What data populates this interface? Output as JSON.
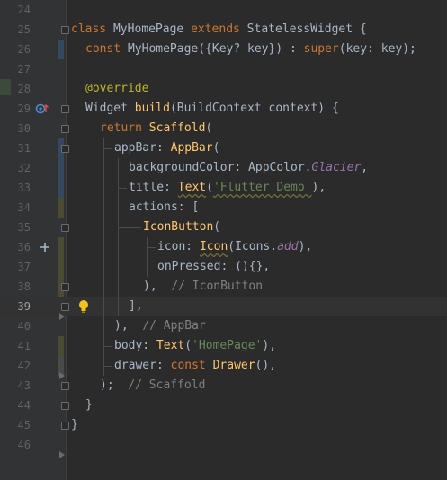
{
  "editor": {
    "current_line": "39",
    "lines": [
      {
        "num": "24"
      },
      {
        "num": "25"
      },
      {
        "num": "26"
      },
      {
        "num": "27"
      },
      {
        "num": "28"
      },
      {
        "num": "29"
      },
      {
        "num": "30"
      },
      {
        "num": "31"
      },
      {
        "num": "32"
      },
      {
        "num": "33"
      },
      {
        "num": "34"
      },
      {
        "num": "35"
      },
      {
        "num": "36"
      },
      {
        "num": "37"
      },
      {
        "num": "38"
      },
      {
        "num": "39"
      },
      {
        "num": "40"
      },
      {
        "num": "41"
      },
      {
        "num": "42"
      },
      {
        "num": "43"
      },
      {
        "num": "44"
      },
      {
        "num": "45"
      },
      {
        "num": "46"
      }
    ],
    "tokens": {
      "l25": {
        "kw1": "class",
        "name": " MyHomePage ",
        "kw2": "extends",
        "rest": " StatelessWidget {"
      },
      "l26": {
        "kw": "const",
        "rest": " MyHomePage({Key? key}) : ",
        "sup": "super",
        "rest2": "(key: key);"
      },
      "l28": {
        "anno": "@override"
      },
      "l29": {
        "a": "Widget ",
        "fn": "build",
        "b": "(BuildContext context) {"
      },
      "l30": {
        "kw": "return",
        "fn": " Scaffold",
        "b": "("
      },
      "l31": {
        "a": "appBar: ",
        "fn": "AppBar",
        "b": "("
      },
      "l32": {
        "a": "backgroundColor: AppColor.",
        "fld": "Glacier",
        "b": ","
      },
      "l33": {
        "a": "title: ",
        "fn": "Text",
        "b": "(",
        "str": "'Flutter Demo'",
        "c": "),"
      },
      "l34": {
        "a": "actions: ["
      },
      "l35": {
        "fn": "IconButton",
        "b": "("
      },
      "l36": {
        "a": "icon: ",
        "fn": "Icon",
        "b": "(Icons.",
        "fld": "add",
        "c": "),"
      },
      "l37": {
        "a": "onPressed: (){},"
      },
      "l38": {
        "a": "),  ",
        "cmt": "// IconButton"
      },
      "l39": {
        "a": "],"
      },
      "l40": {
        "a": "),  ",
        "cmt": "// AppBar"
      },
      "l41": {
        "a": "body: ",
        "fn": "Text",
        "b": "(",
        "str": "'HomePage'",
        "c": "),"
      },
      "l42": {
        "a": "drawer: ",
        "kw": "const",
        "fn": " Drawer",
        "b": "(),"
      },
      "l43": {
        "a": ");  ",
        "cmt": "// Scaffold"
      },
      "l44": {
        "a": "}"
      },
      "l45": {
        "a": "}"
      }
    }
  },
  "gutter_icons": {
    "override": "override-marker-icon",
    "add": "add-icon-preview",
    "bulb": "intention-bulb-icon"
  },
  "colors": {
    "background": "#2b2b2b",
    "keyword": "#cc7832",
    "function": "#ffc66d",
    "string": "#6a8759",
    "annotation": "#bbb529",
    "comment": "#808080",
    "field": "#9876aa"
  }
}
